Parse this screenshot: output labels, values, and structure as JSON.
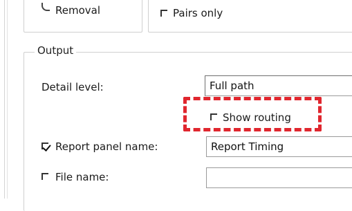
{
  "analysis": {
    "removal_radio_label": "Removal",
    "pairs_only_label": "Pairs only"
  },
  "output": {
    "group_title": "Output",
    "detail_level_label": "Detail level:",
    "detail_level_value": "Full path",
    "show_routing_label": "Show routing",
    "report_panel_label": "Report panel name:",
    "report_panel_value": "Report Timing",
    "report_panel_checked": true,
    "file_name_label": "File name:",
    "file_name_value": "",
    "file_name_checked": false
  },
  "annotation": {
    "highlight_color": "#e0262e",
    "highlight_target": "show-routing-checkbox"
  }
}
